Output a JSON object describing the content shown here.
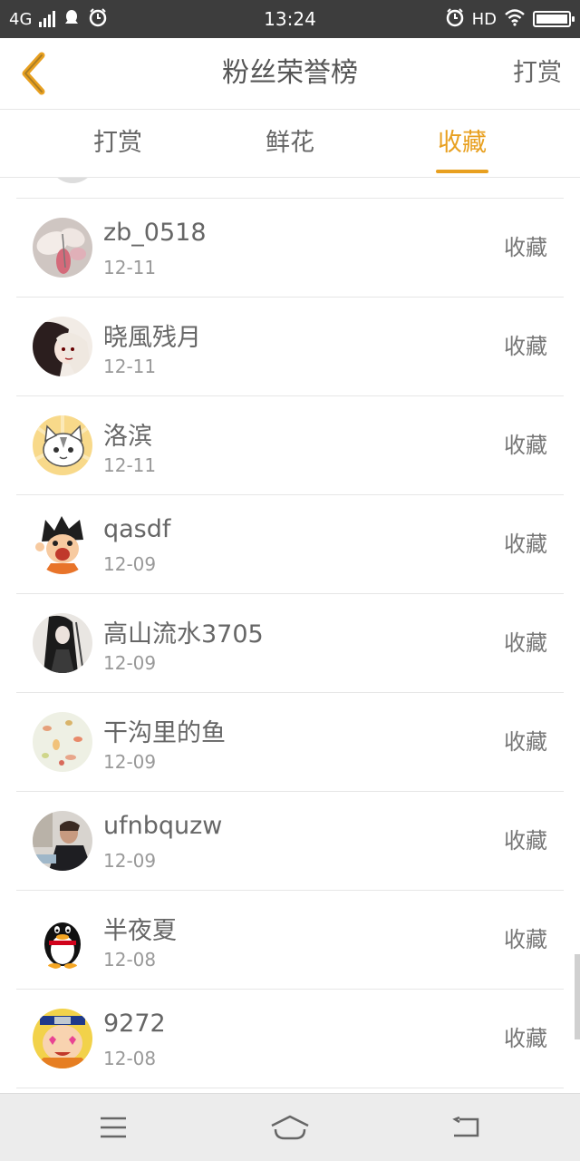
{
  "status_bar": {
    "network": "4G",
    "time": "13:24",
    "hd": "HD"
  },
  "header": {
    "title": "粉丝荣誉榜",
    "action_label": "打赏"
  },
  "tabs": [
    {
      "label": "打赏",
      "active": false
    },
    {
      "label": "鲜花",
      "active": false
    },
    {
      "label": "收藏",
      "active": true
    }
  ],
  "accent_color": "#e8a020",
  "list": [
    {
      "name": "zb_0518",
      "date": "12-11",
      "action": "收藏",
      "avatar": "butterfly-avatar"
    },
    {
      "name": "晓風残月",
      "date": "12-11",
      "action": "收藏",
      "avatar": "anime-girl-avatar"
    },
    {
      "name": "洛滨",
      "date": "12-11",
      "action": "收藏",
      "avatar": "cat-avatar"
    },
    {
      "name": "qasdf",
      "date": "12-09",
      "action": "收藏",
      "avatar": "cartoon-boy-avatar"
    },
    {
      "name": "高山流水3705",
      "date": "12-09",
      "action": "收藏",
      "avatar": "swordsman-avatar"
    },
    {
      "name": "干沟里的鱼",
      "date": "12-09",
      "action": "收藏",
      "avatar": "petals-avatar"
    },
    {
      "name": "ufnbquzw",
      "date": "12-09",
      "action": "收藏",
      "avatar": "man-photo-avatar"
    },
    {
      "name": "半夜夏",
      "date": "12-08",
      "action": "收藏",
      "avatar": "penguin-avatar"
    },
    {
      "name": "9272",
      "date": "12-08",
      "action": "收藏",
      "avatar": "ninja-avatar"
    }
  ]
}
